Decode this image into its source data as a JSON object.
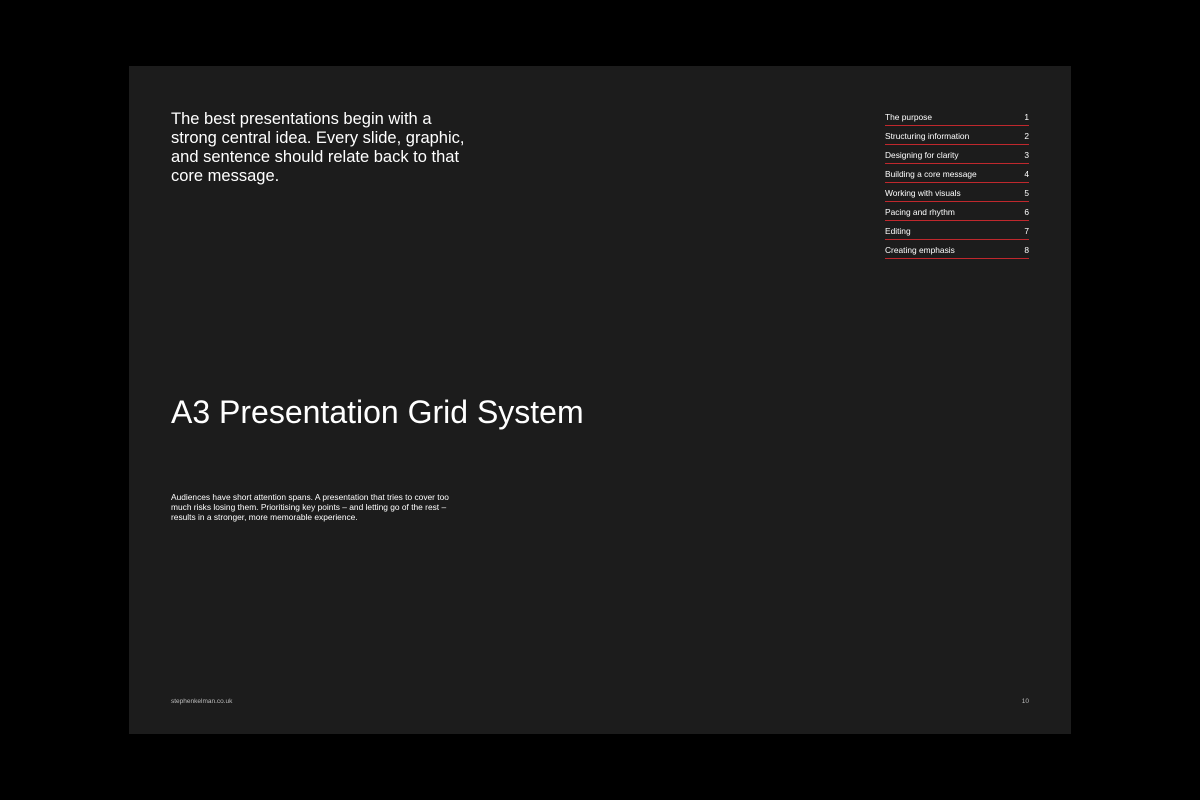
{
  "intro": "The best presentations begin with a strong central idea. Every slide, graphic, and sentence should relate back to that core message.",
  "title": "A3 Presentation Grid System",
  "body": "Audiences have short attention spans. A presentation that tries to cover too much risks losing them. Prioritising key points – and letting go of the rest – results in a stronger, more memorable experience.",
  "toc": {
    "items": [
      {
        "label": "The purpose",
        "number": "1"
      },
      {
        "label": "Structuring information",
        "number": "2"
      },
      {
        "label": "Designing for clarity",
        "number": "3"
      },
      {
        "label": "Building a core message",
        "number": "4"
      },
      {
        "label": "Working with visuals",
        "number": "5"
      },
      {
        "label": "Pacing and rhythm",
        "number": "6"
      },
      {
        "label": "Editing",
        "number": "7"
      },
      {
        "label": "Creating emphasis",
        "number": "8"
      }
    ]
  },
  "footer": {
    "site": "stephenkelman.co.uk",
    "page_number": "10"
  },
  "colors": {
    "background": "#000000",
    "slide": "#1c1c1c",
    "text": "#ffffff",
    "accent_rule": "#c0282d"
  }
}
